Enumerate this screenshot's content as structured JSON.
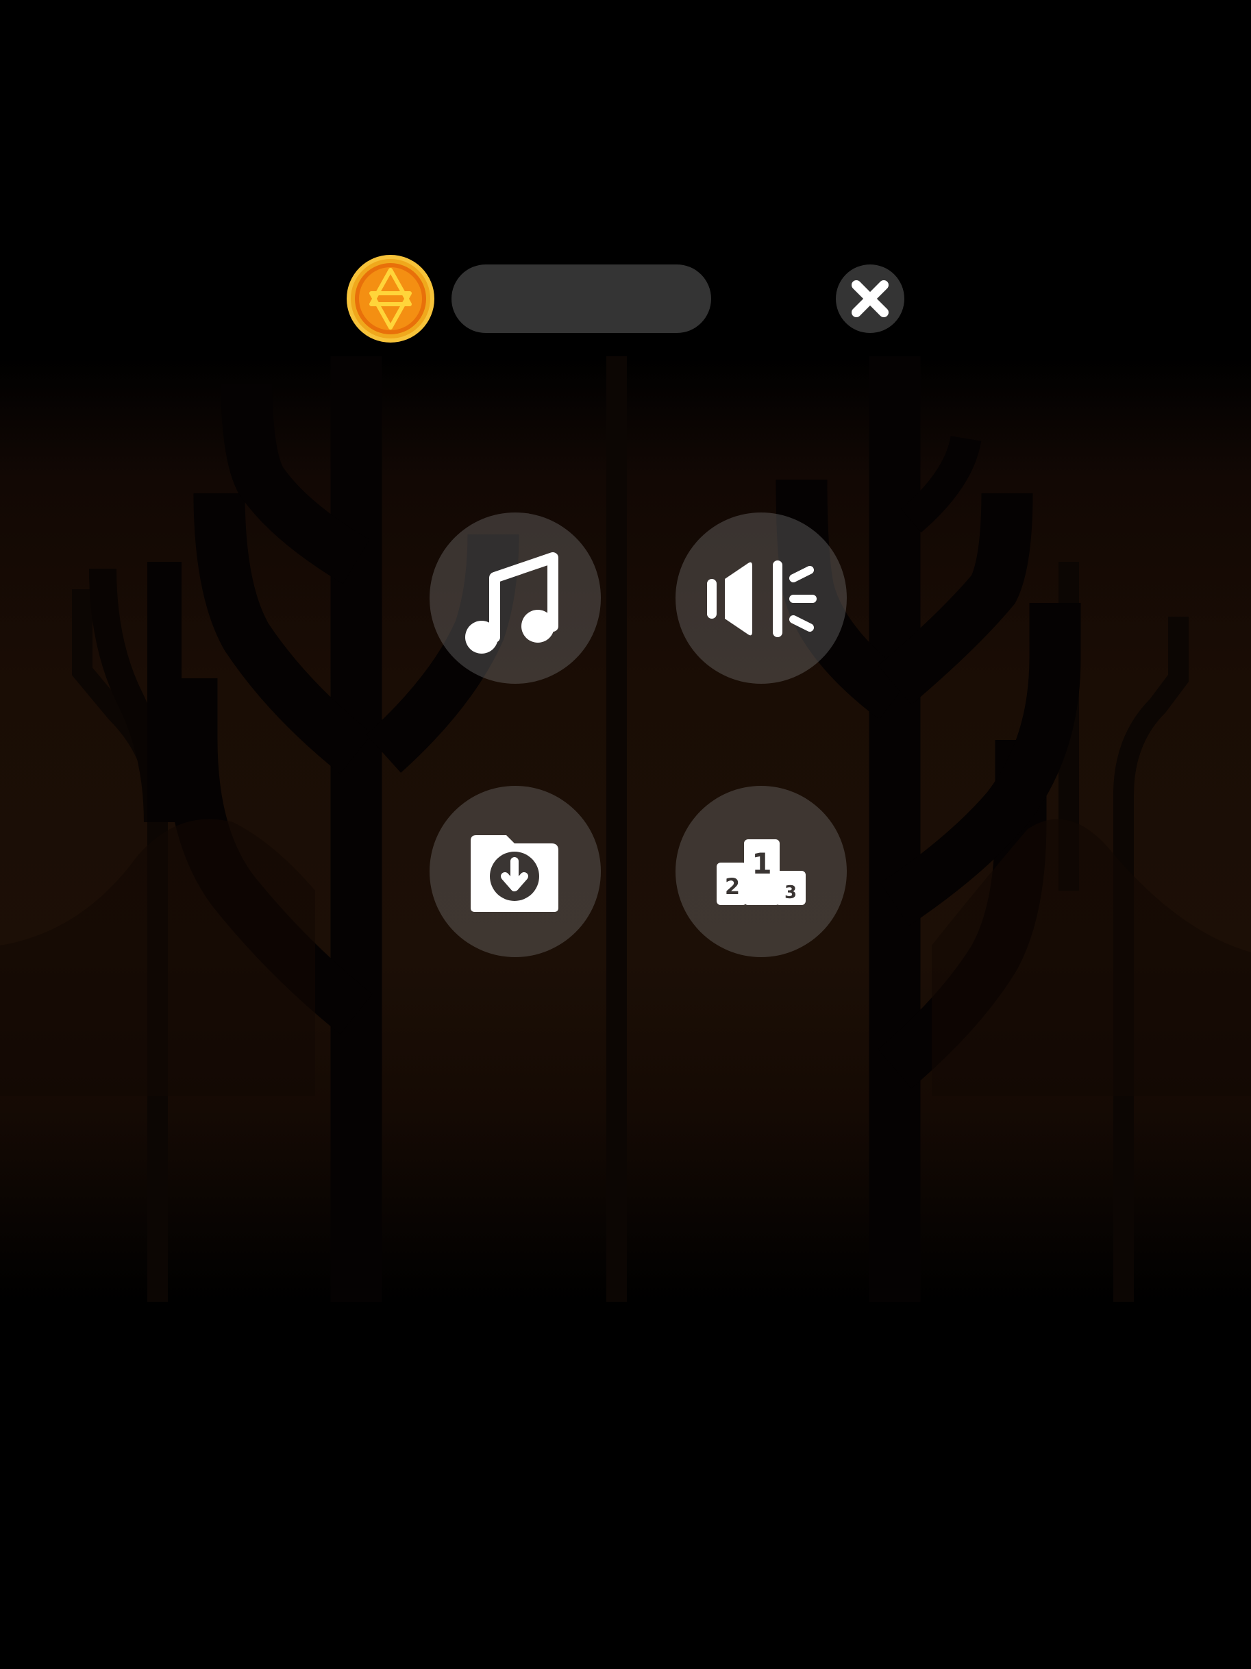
{
  "header": {
    "coin_icon": "star-of-david-coin-icon",
    "name_bar_text": "",
    "close_icon": "close-icon"
  },
  "menu": {
    "buttons": [
      {
        "id": "music",
        "icon": "music-note-icon"
      },
      {
        "id": "sound",
        "icon": "speaker-icon"
      },
      {
        "id": "save",
        "icon": "folder-download-icon"
      },
      {
        "id": "leaderboard",
        "icon": "podium-icon"
      }
    ],
    "podium_labels": [
      "1",
      "2",
      "3"
    ]
  },
  "colors": {
    "background": "#000000",
    "panel": "#343434",
    "button_fill": "#5a5450",
    "coin_outer": "#f5b422",
    "coin_inner": "#f08a0c",
    "icon": "#ffffff"
  }
}
